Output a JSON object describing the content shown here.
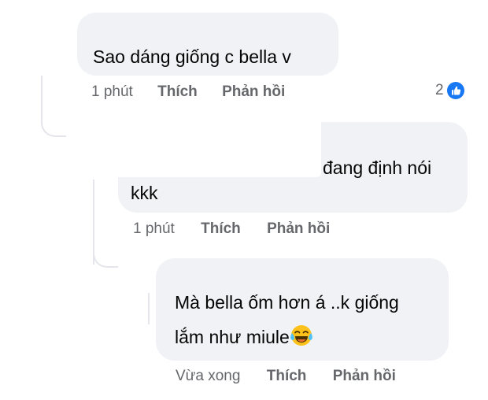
{
  "comments": [
    {
      "text": "Sao dáng giống c bella v",
      "time": "1 phút",
      "like_label": "Thích",
      "reply_label": "Phản hồi",
      "reaction_count": "2",
      "reaction_icon": "like-icon"
    },
    {
      "text_line1": "đang định nói",
      "text_line2": "kkk",
      "time": "1 phút",
      "like_label": "Thích",
      "reply_label": "Phản hồi"
    },
    {
      "text_line1": "Mà bella ốm hơn á ..k giống",
      "text_line2": "lắm như miule",
      "emoji": "face-with-tears-of-joy-icon",
      "time": "Vừa xong",
      "like_label": "Thích",
      "reply_label": "Phản hồi"
    }
  ],
  "colors": {
    "bubble": "#f0f2f5",
    "meta_text": "#65676b",
    "like_blue": "#1877f2",
    "thread_line": "#e4e6eb"
  }
}
